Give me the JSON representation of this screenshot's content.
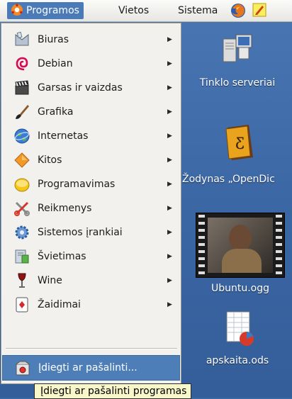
{
  "panel": {
    "programs": "Programos",
    "places": "Vietos",
    "system": "Sistema",
    "icons": [
      "distro-logo-icon",
      "firefox-icon",
      "notes-icon"
    ]
  },
  "menu": {
    "items": [
      {
        "label": "Biuras",
        "icon": "office-icon",
        "submenu": true
      },
      {
        "label": "Debian",
        "icon": "debian-swirl-icon",
        "submenu": true
      },
      {
        "label": "Garsas ir vaizdas",
        "icon": "clapperboard-icon",
        "submenu": true
      },
      {
        "label": "Grafika",
        "icon": "paintbrush-icon",
        "submenu": true
      },
      {
        "label": "Internetas",
        "icon": "globe-icon",
        "submenu": true
      },
      {
        "label": "Kitos",
        "icon": "diamond-icon",
        "submenu": true
      },
      {
        "label": "Programavimas",
        "icon": "programming-icon",
        "submenu": true
      },
      {
        "label": "Reikmenys",
        "icon": "tools-icon",
        "submenu": true
      },
      {
        "label": "Sistemos įrankiai",
        "icon": "system-gear-icon",
        "submenu": true
      },
      {
        "label": "Švietimas",
        "icon": "education-icon",
        "submenu": true
      },
      {
        "label": "Wine",
        "icon": "wine-glass-icon",
        "submenu": true
      },
      {
        "label": "Žaidimai",
        "icon": "playing-card-icon",
        "submenu": true
      }
    ],
    "install": {
      "label": "Įdiegti ar pašalinti...",
      "icon": "package-install-icon"
    },
    "arrow": "▶"
  },
  "tooltip": "Įdiegti ar pašalinti programas",
  "desktop": {
    "icons": [
      {
        "label": "Tinklo serveriai",
        "icon": "network-servers-icon"
      },
      {
        "label": "Žodynas „OpenDic",
        "icon": "dictionary-icon"
      },
      {
        "label": "Ubuntu.ogg",
        "icon": "video-thumbnail-icon"
      },
      {
        "label": "apskaita.ods",
        "icon": "spreadsheet-icon"
      }
    ]
  },
  "colors": {
    "selection": "#4d7eb8",
    "menu_bg": "#f2f1ee",
    "desktop": "#3b67a3",
    "tooltip_bg": "#f7f7c9"
  }
}
